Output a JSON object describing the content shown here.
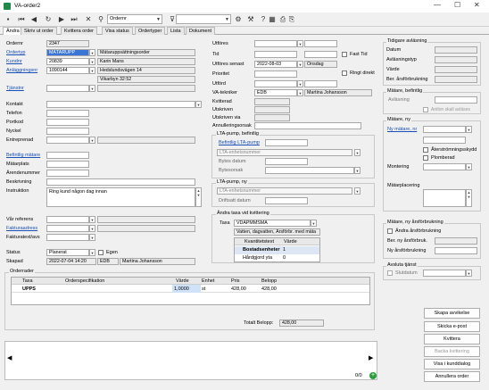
{
  "window": {
    "title": "VA-order2"
  },
  "toolbar": {
    "search_value": "Ordernr"
  },
  "tabs": [
    "Ändra",
    "Skriv ut order",
    "Kvittera order",
    "Visa status",
    "Ordertyper",
    "Lista",
    "Dokument"
  ],
  "left": {
    "ordernr_label": "Ordernr",
    "ordernr": "2347",
    "ordertyp_label": "Ordertyp",
    "ordertyp_code": "MÄTARUPP",
    "ordertyp_desc": "Mätaruppsättningsorder",
    "kunder_label": "Kundnr",
    "kundnr": "20839",
    "kund_name": "Karin Mans",
    "anl_label": "Anläggningsnr",
    "anlnr": "1090144",
    "anl_addr1": "Hedslundsvägen 14",
    "anl_addr2": "Vikarbyn 32:52",
    "tjanst_label": "Tjänstnr",
    "kontakt_label": "Kontakt",
    "telefon_label": "Telefon",
    "portkod_label": "Portkod",
    "nyckel_label": "Nyckel",
    "entreprenad_label": "Entreprenad",
    "befintlig_label": "Befintlig mätare",
    "matarplats_label": "Mätarplats",
    "arendenummer_label": "Ärendenummer",
    "beskrivning_label": "Beskrivning",
    "instruktion_label": "Instruktion",
    "instruktion_text": "Ring kund någon dag innan",
    "var_ref_label": "Vår referens",
    "fakturaadress_label": "Fakturaadress",
    "fakturatext_label": "Fakturatext/avs",
    "status_label": "Status",
    "status_value": "Planerat",
    "egen_label": "Egen",
    "skapad_label": "Skapad",
    "skapad_date": "2022-07-04 14:20",
    "skapad_user": "EDB",
    "skapad_name": "Martina Johansson"
  },
  "middle": {
    "utfores_label": "Utföres",
    "tid_label": "Tid",
    "fast_tid_label": "Fast Tid",
    "utfores_senast_label": "Utföres senast",
    "utfores_senast_date": "2022-08-03",
    "utfores_senast_day": "Onsdag",
    "ringt_label": "Ringt direkt",
    "prioritet_label": "Prioritet",
    "utford_label": "Utförd",
    "tekniker_label": "VA-tekniker",
    "tekniker_code": "EDB",
    "tekniker_name": "Martina Johansson",
    "kvitterad_label": "Kvitterad",
    "utskriven_label": "Utskriven",
    "utskriven_via_label": "Utskriven via",
    "annullering_label": "Annulleringsorsak",
    "lta_bef_title": "LTA-pump, befintlig",
    "lta_bef_link": "Befintlig LTA-pump",
    "lta_enh_label": "LTA-enhetsnummer",
    "bytes_datum_label": "Bytes datum",
    "bytesorsak_label": "Bytesorsak",
    "lta_ny_title": "LTA-pump, ny",
    "lta_ny_enh_label": "LTA-enhetsnummer",
    "driftsatt_label": "Driftsatt datum",
    "taxa_title": "Ändra taxa vid kvittering",
    "taxa_label": "Taxa",
    "taxa_value": "VDÄPMMSMÄ",
    "taxa_desc": "Vatten, dagvatten, Årsförbr. med mäta",
    "kvant_headers": [
      "Kvantitetstext",
      "Värde"
    ],
    "kvant_rows": [
      [
        "Bostadsenheter",
        "1"
      ],
      [
        "Hårdgjord yta",
        "0"
      ]
    ]
  },
  "right": {
    "tidigare_title": "Tidigare avläsning",
    "datum_label": "Datum",
    "avlasningtyp_label": "Avläsningstyp",
    "varde_label": "Värde",
    "ber_label": "Ber. årsförbrukning",
    "bef_title": "Mätare, befintlig",
    "avlasning_label": "Avläsning",
    "anton_label": "Antlon skall avläses",
    "ny_title": "Mätare, ny",
    "ny_link": "Ny mätare, nr",
    "aterstromning_label": "Återströmningsskydd",
    "plomberad_label": "Plomberad",
    "montering_label": "Montering",
    "matarplacering_label": "Mätarplacering",
    "ny_ars_title": "Mätare, ny årsförbrukning",
    "andra_ars_label": "Ändra årsförbrukning",
    "ber_ars_label": "Ber. ny årsförbruk.",
    "ny_ars_label": "Ny årsförbrukning",
    "avsluta_title": "Avsluta tjänst",
    "slutdatum_label": "Slutdatum"
  },
  "orderrader": {
    "title": "Orderrader",
    "headers": [
      "Taxa",
      "Orderspecifikation",
      "Värde",
      "Enhet",
      "Pris",
      "Belopp"
    ],
    "rows": [
      [
        "UPPS",
        "",
        "1,0000",
        "st",
        "428,00",
        "428,00"
      ]
    ],
    "totalt_label": "Totalt Belopp:",
    "totalt_value": "428,00"
  },
  "pager": "0/0",
  "buttons": [
    "Skapa avvikelse",
    "Skicka e-post",
    "Kvittera",
    "Backa kvittering",
    "Visa i kunddialog",
    "Annullera order"
  ]
}
